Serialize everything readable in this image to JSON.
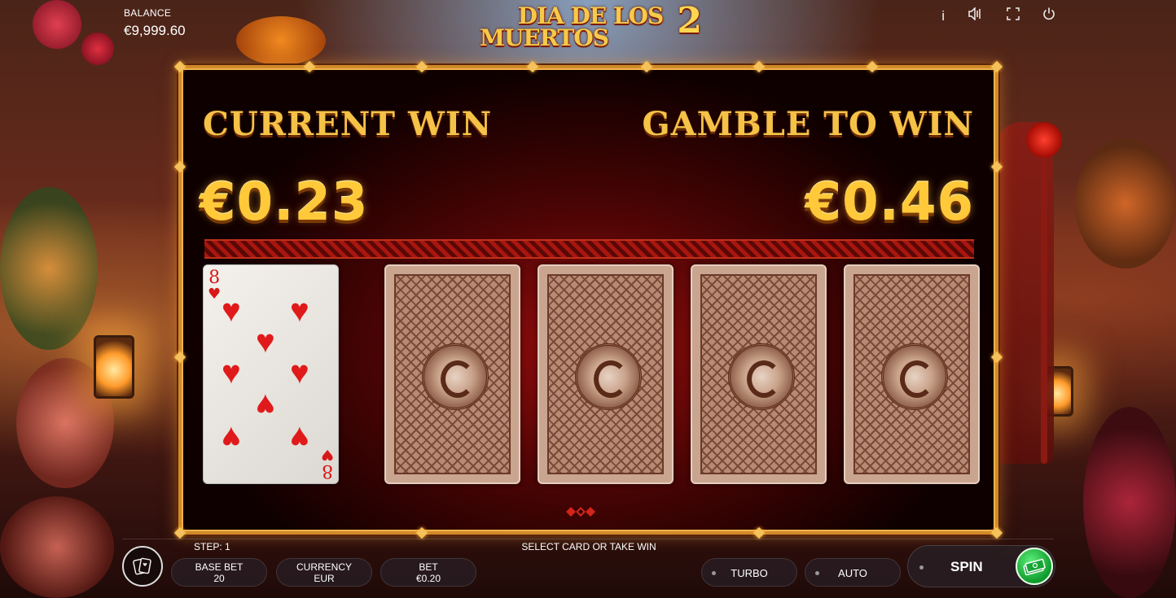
{
  "balance": {
    "label": "BALANCE",
    "value": "€9,999.60"
  },
  "logo": {
    "line1": "DIA DE LOS",
    "line2": "MUERTOS",
    "number": "2"
  },
  "top_icons": {
    "info": "i",
    "sound": "◁))",
    "fullscreen": "⛶",
    "power": "⏻"
  },
  "gamble": {
    "current_win_label": "CURRENT WIN",
    "current_win_value": "€0.23",
    "gamble_to_win_label": "GAMBLE TO WIN",
    "gamble_to_win_value": "€0.46",
    "revealed_card": {
      "rank": "8",
      "suit": "♥"
    },
    "hidden_cards": 4
  },
  "status": {
    "step": "STEP: 1",
    "message": "SELECT CARD OR TAKE WIN"
  },
  "controls": {
    "base_bet_label": "BASE BET",
    "base_bet_value": "20",
    "currency_label": "CURRENCY",
    "currency_value": "EUR",
    "bet_label": "BET",
    "bet_value": "€0.20",
    "turbo_label": "TURBO",
    "auto_label": "AUTO",
    "spin_label": "SPIN"
  },
  "colors": {
    "gold": "#f5c248",
    "frame": "#d08a2a",
    "spin_green": "#0e9a2c",
    "heart": "#e01a1a"
  }
}
